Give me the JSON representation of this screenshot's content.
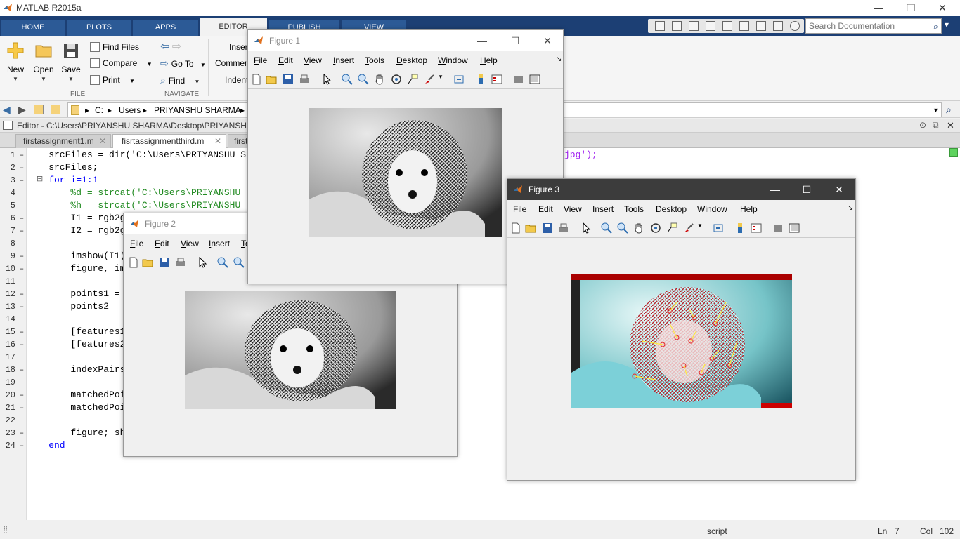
{
  "app": {
    "title": "MATLAB R2015a",
    "min": "—",
    "restore": "❐",
    "close": "✕"
  },
  "ribbon_tabs": [
    "HOME",
    "PLOTS",
    "APPS",
    "EDITOR",
    "PUBLISH",
    "VIEW"
  ],
  "search": {
    "placeholder": "Search Documentation"
  },
  "ribbon": {
    "new": "New",
    "open": "Open",
    "save": "Save",
    "find_files": "Find Files",
    "compare": "Compare",
    "print": "Print",
    "go_to": "Go To",
    "find": "Find",
    "insert": "Insert",
    "comment": "Comment",
    "indent": "Indent",
    "group_file": "FILE",
    "group_navigate": "NAVIGATE"
  },
  "address": {
    "crumbs": [
      "C:",
      "Users",
      "PRIYANSHU SHARMA"
    ]
  },
  "editor": {
    "header": "Editor - C:\\Users\\PRIYANSHU SHARMA\\Desktop\\PRIYANSHU\\",
    "tabs": [
      "firstassignment1.m",
      "fisrtassignmentthird.m",
      "first"
    ],
    "tab_close": "✕",
    "lines": [
      {
        "n": "1",
        "dash": true,
        "code": "    srcFiles = dir('C:\\Users\\PRIYANSHU S",
        "tail": "jpg');"
      },
      {
        "n": "2",
        "dash": true,
        "code": "    srcFiles;"
      },
      {
        "n": "3",
        "dash": true,
        "code": "    for i=1:1"
      },
      {
        "n": "4",
        "dash": false,
        "code": "        %d = strcat('C:\\Users\\PRIYANSHU"
      },
      {
        "n": "5",
        "dash": false,
        "code": "        %h = strcat('C:\\Users\\PRIYANSHU"
      },
      {
        "n": "6",
        "dash": true,
        "code": "        I1 = rgb2g"
      },
      {
        "n": "7",
        "dash": true,
        "code": "        I2 = rgb2g"
      },
      {
        "n": "8",
        "dash": false,
        "code": ""
      },
      {
        "n": "9",
        "dash": true,
        "code": "        imshow(I1)"
      },
      {
        "n": "10",
        "dash": true,
        "code": "        figure, im"
      },
      {
        "n": "11",
        "dash": false,
        "code": ""
      },
      {
        "n": "12",
        "dash": true,
        "code": "        points1 ="
      },
      {
        "n": "13",
        "dash": true,
        "code": "        points2 ="
      },
      {
        "n": "14",
        "dash": false,
        "code": ""
      },
      {
        "n": "15",
        "dash": true,
        "code": "        [features1"
      },
      {
        "n": "16",
        "dash": true,
        "code": "        [features2"
      },
      {
        "n": "17",
        "dash": false,
        "code": ""
      },
      {
        "n": "18",
        "dash": true,
        "code": "        indexPairs"
      },
      {
        "n": "19",
        "dash": false,
        "code": ""
      },
      {
        "n": "20",
        "dash": true,
        "code": "        matchedPoi"
      },
      {
        "n": "21",
        "dash": true,
        "code": "        matchedPoi"
      },
      {
        "n": "22",
        "dash": false,
        "code": ""
      },
      {
        "n": "23",
        "dash": true,
        "code": "        figure; sh"
      },
      {
        "n": "24",
        "dash": true,
        "code": "    end"
      }
    ]
  },
  "statusbar": {
    "mode": "script",
    "ln_label": "Ln",
    "ln": "7",
    "col_label": "Col",
    "col": "102"
  },
  "figure_menu": [
    "File",
    "Edit",
    "View",
    "Insert",
    "Tools",
    "Desktop",
    "Window",
    "Help"
  ],
  "figure_menu_short": [
    "File",
    "Edit",
    "View",
    "Insert",
    "To"
  ],
  "figures": {
    "fig1": "Figure 1",
    "fig2": "Figure 2",
    "fig3": "Figure 3"
  }
}
